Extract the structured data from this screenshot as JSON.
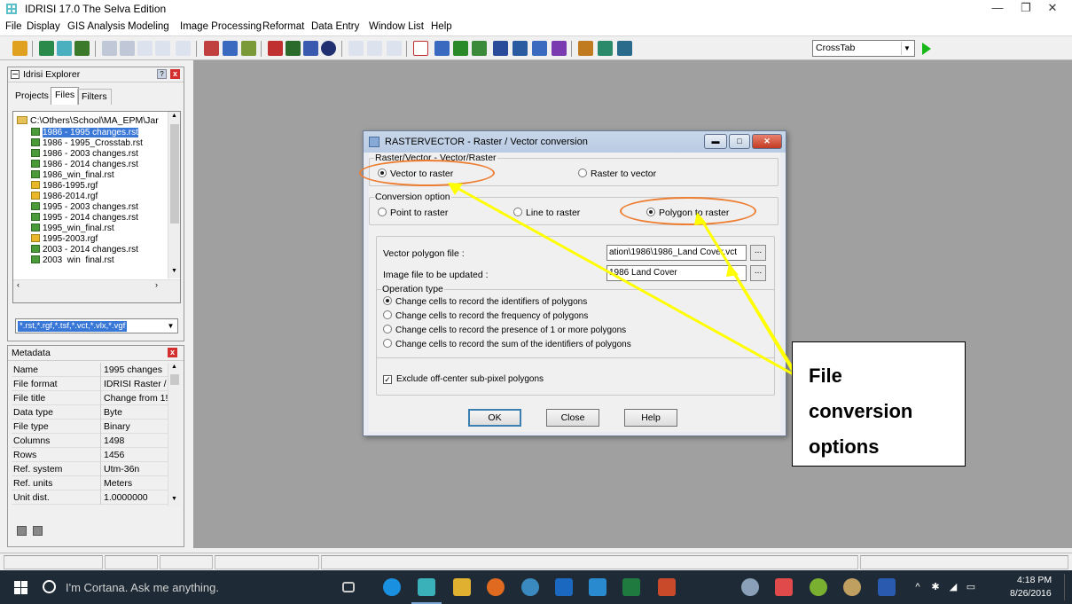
{
  "window": {
    "title": "IDRISI 17.0   The Selva Edition"
  },
  "menu": [
    "File",
    "Display",
    "GIS Analysis",
    "Modeling",
    "Image Processing",
    "Reformat",
    "Data Entry",
    "Window List",
    "Help"
  ],
  "toolbar": {
    "module_select": "CrossTab"
  },
  "explorer": {
    "title": "Idrisi Explorer",
    "tabs": [
      "Projects",
      "Files",
      "Filters"
    ],
    "active_tab": "Files",
    "root_path": "C:\\Others\\School\\MA_EPM\\Jar",
    "files": [
      {
        "name": "1986 - 1995 changes.rst",
        "type": "rst",
        "selected": true
      },
      {
        "name": "1986 - 1995_Crosstab.rst",
        "type": "rst"
      },
      {
        "name": "1986 - 2003 changes.rst",
        "type": "rst"
      },
      {
        "name": "1986 - 2014 changes.rst",
        "type": "rst"
      },
      {
        "name": "1986_win_final.rst",
        "type": "rst"
      },
      {
        "name": "1986-1995.rgf",
        "type": "rgf"
      },
      {
        "name": "1986-2014.rgf",
        "type": "rgf"
      },
      {
        "name": "1995 - 2003 changes.rst",
        "type": "rst"
      },
      {
        "name": "1995 - 2014 changes.rst",
        "type": "rst"
      },
      {
        "name": "1995_win_final.rst",
        "type": "rst"
      },
      {
        "name": "1995-2003.rgf",
        "type": "rgf"
      },
      {
        "name": "2003 - 2014 changes.rst",
        "type": "rst"
      },
      {
        "name": "2003_win_final.rst",
        "type": "rst"
      }
    ],
    "filter": "*.rst,*.rgf,*.tsf,*.vct,*.vlx,*.vgf"
  },
  "metadata": {
    "title": "Metadata",
    "rows": [
      {
        "key": "Name",
        "value": "1995 changes"
      },
      {
        "key": "File format",
        "value": "IDRISI Raster /"
      },
      {
        "key": "File title",
        "value": "Change from 1!"
      },
      {
        "key": "Data type",
        "value": "Byte"
      },
      {
        "key": "File type",
        "value": "Binary"
      },
      {
        "key": "Columns",
        "value": "1498"
      },
      {
        "key": "Rows",
        "value": "1456"
      },
      {
        "key": "Ref. system",
        "value": "Utm-36n"
      },
      {
        "key": "Ref. units",
        "value": "Meters"
      },
      {
        "key": "Unit dist.",
        "value": "1.0000000"
      }
    ]
  },
  "dialog": {
    "title": "RASTERVECTOR - Raster / Vector conversion",
    "direction_group": "Raster/Vector - Vector/Raster",
    "vector_to_raster": "Vector to raster",
    "raster_to_vector": "Raster to vector",
    "conversion_group": "Conversion option",
    "point_to_raster": "Point to raster",
    "line_to_raster": "Line to raster",
    "polygon_to_raster": "Polygon to raster",
    "vector_file_label": "Vector polygon file :",
    "vector_file_value": "ation\\1986\\1986_Land Cover.vct",
    "image_file_label": "Image file to be updated :",
    "image_file_value": "1986 Land Cover",
    "browse": "...",
    "operation_group": "Operation type",
    "operations": [
      "Change cells to record the identifiers of polygons",
      "Change cells to record the frequency of polygons",
      "Change cells to record the presence of 1 or more polygons",
      "Change cells to record the sum of the identifiers of polygons"
    ],
    "exclude_label": "Exclude off-center sub-pixel polygons",
    "ok": "OK",
    "close": "Close",
    "help": "Help"
  },
  "callout": {
    "line1": "File",
    "line2": "conversion",
    "line3": "options"
  },
  "colors": {
    "annotation_ellipse": "#ed7d31",
    "arrow": "#ffff00",
    "workspace": "#a0a0a0"
  },
  "taskbar": {
    "search_placeholder": "I'm Cortana. Ask me anything.",
    "time": "4:18 PM",
    "date": "8/26/2016"
  }
}
